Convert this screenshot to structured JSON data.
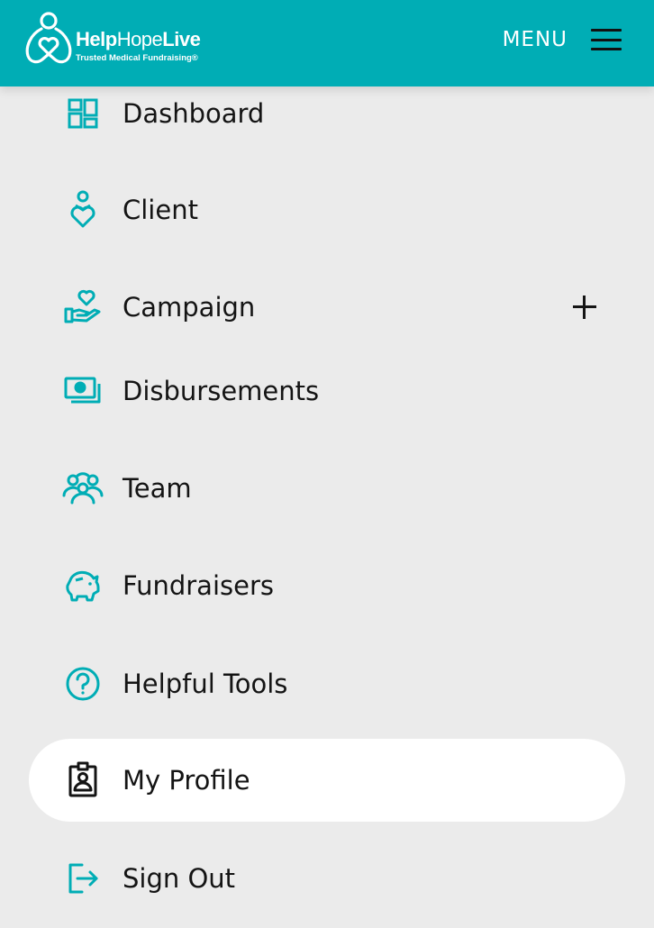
{
  "header": {
    "brand": {
      "part1": "Help",
      "part2": "Hope",
      "part3": "Live",
      "tagline": "Trusted Medical Fundraising®"
    },
    "menu_label": "MENU"
  },
  "nav": {
    "items": [
      {
        "label": "Dashboard",
        "icon": "dashboard-icon"
      },
      {
        "label": "Client",
        "icon": "client-icon"
      },
      {
        "label": "Campaign",
        "icon": "campaign-icon",
        "expandable": true
      },
      {
        "label": "Disbursements",
        "icon": "disbursements-icon"
      },
      {
        "label": "Team",
        "icon": "team-icon"
      },
      {
        "label": "Fundraisers",
        "icon": "piggy-bank-icon"
      },
      {
        "label": "Helpful Tools",
        "icon": "help-circle-icon"
      },
      {
        "label": "My Profile",
        "icon": "profile-badge-icon",
        "active": true
      },
      {
        "label": "Sign Out",
        "icon": "sign-out-icon"
      }
    ]
  },
  "colors": {
    "brand": "#00adb5",
    "background": "#ebebeb",
    "active_item": "#ffffff",
    "text": "#141414"
  }
}
